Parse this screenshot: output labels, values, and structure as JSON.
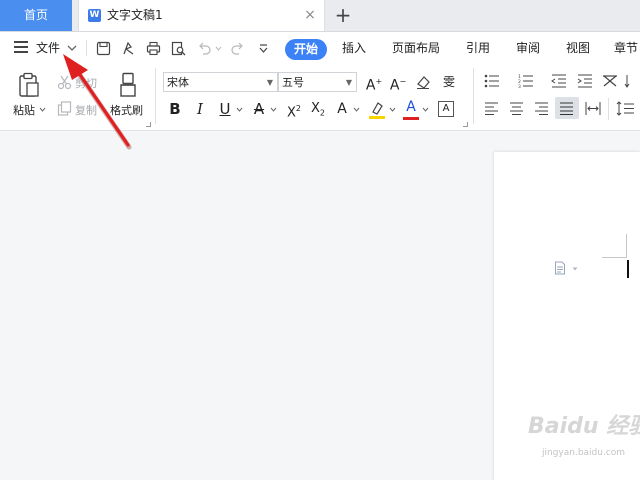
{
  "tabs": {
    "home_label": "首页",
    "doc_title": "文字文稿1",
    "doc_icon_letter": "W",
    "close_symbol": "×",
    "new_tab_symbol": "+"
  },
  "menu": {
    "file_label": "文件",
    "ribbon_tabs": [
      "开始",
      "插入",
      "页面布局",
      "引用",
      "审阅",
      "视图",
      "章节"
    ]
  },
  "clipboard": {
    "paste_label": "粘贴",
    "cut_label": "剪切",
    "copy_label": "复制",
    "format_painter_label": "格式刷"
  },
  "font": {
    "family": "宋体",
    "size": "五号"
  },
  "watermark": {
    "brand": "Baidu 经验",
    "url": "jingyan.baidu.com"
  },
  "colors": {
    "accent": "#3b82f6",
    "home_tab": "#4a8ef0",
    "arrow": "#e02020",
    "highlight": "#f5d400",
    "font_color": "#e02020"
  }
}
